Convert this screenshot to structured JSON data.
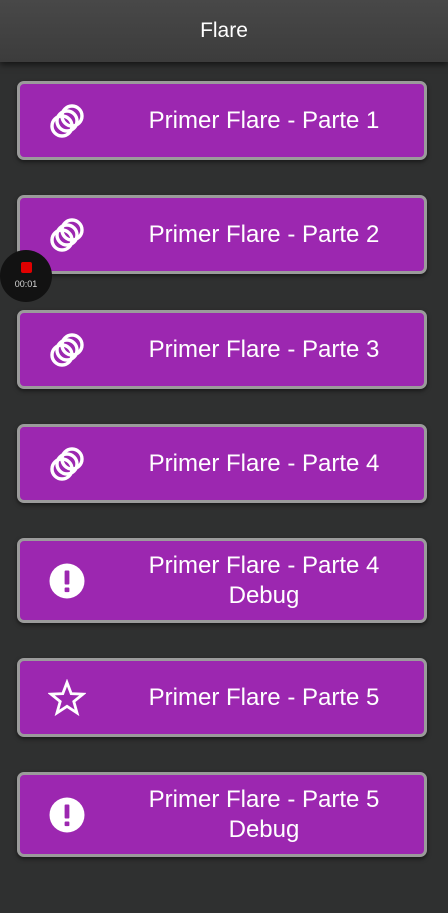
{
  "app": {
    "title": "Flare"
  },
  "buttons": [
    {
      "label": "Primer Flare - Parte 1",
      "icon": "circles-icon"
    },
    {
      "label": "Primer Flare - Parte 2",
      "icon": "circles-icon"
    },
    {
      "label": "Primer Flare - Parte 3",
      "icon": "circles-icon"
    },
    {
      "label": "Primer Flare - Parte 4",
      "icon": "circles-icon"
    },
    {
      "label": "Primer Flare - Parte 4\nDebug",
      "icon": "alert-icon"
    },
    {
      "label": "Primer Flare - Parte 5",
      "icon": "star-icon"
    },
    {
      "label": "Primer Flare - Parte 5\nDebug",
      "icon": "alert-icon"
    }
  ],
  "recorder": {
    "time": "00:01"
  },
  "colors": {
    "appbar": "#424242",
    "background": "#303030",
    "button_fill": "#9c27b0",
    "button_border": "#9b9b9b",
    "text": "#ffffff",
    "record_dot": "#e00000"
  }
}
